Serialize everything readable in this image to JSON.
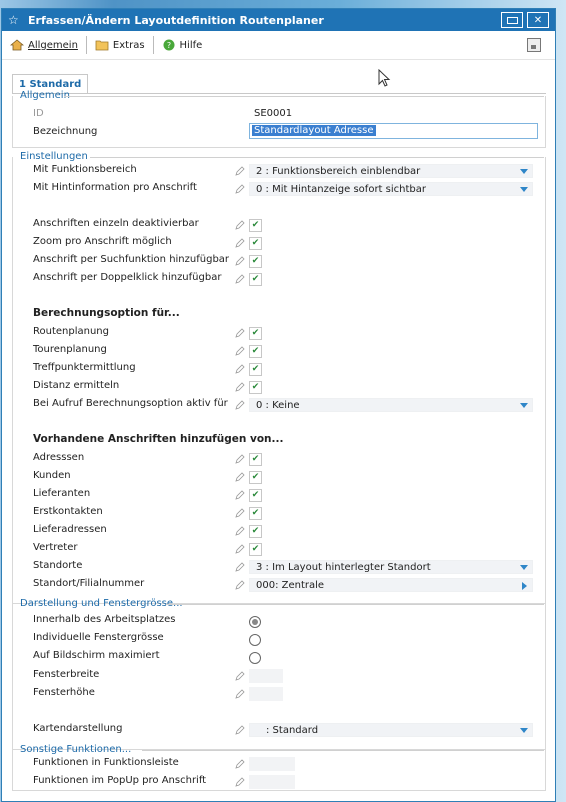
{
  "window": {
    "title": "Erfassen/Ändern Layoutdefinition Routenplaner"
  },
  "toolbar": {
    "allgemein": "Allgemein",
    "extras": "Extras",
    "hilfe": "Hilfe"
  },
  "tab": {
    "label": "1 Standard"
  },
  "sections": {
    "allgemein": "Allgemein",
    "einstellungen": "Einstellungen",
    "darstellung": "Darstellung und Fenstergrösse...",
    "sonstige": "Sonstige Funktionen..."
  },
  "allgemein": {
    "id_label": "ID",
    "id_value": "SE0001",
    "bez_label": "Bezeichnung",
    "bez_value": "Standardlayout Adresse"
  },
  "einstellungen": {
    "funktionsbereich_label": "Mit Funktionsbereich",
    "funktionsbereich_value": "2 : Funktionsbereich einblendbar",
    "hint_label": "Mit Hintinformation pro Anschrift",
    "hint_value": "0 : Mit Hintanzeige sofort sichtbar",
    "c1": "Anschriften einzeln deaktivierbar",
    "c2": "Zoom pro Anschrift möglich",
    "c3": "Anschrift per Suchfunktion hinzufügbar",
    "c4": "Anschrift per Doppelklick hinzufügbar",
    "berechnung_heading": "Berechnungsoption für...",
    "b1": "Routenplanung",
    "b2": "Tourenplanung",
    "b3": "Treffpunktermittlung",
    "b4": "Distanz ermitteln",
    "b5_label": "Bei Aufruf Berechnungsoption aktiv für",
    "b5_value": "0 : Keine",
    "vorhanden_heading": "Vorhandene Anschriften hinzufügen von...",
    "v1": "Adresssen",
    "v2": "Kunden",
    "v3": "Lieferanten",
    "v4": "Erstkontakten",
    "v5": "Lieferadressen",
    "v6": "Vertreter",
    "standorte_label": "Standorte",
    "standorte_value": "3 : Im Layout hinterlegter Standort",
    "filial_label": "Standort/Filialnummer",
    "filial_value": "000: Zentrale"
  },
  "darstellung": {
    "r1": "Innerhalb des Arbeitsplatzes",
    "r2": "Individuelle Fenstergrösse",
    "r3": "Auf Bildschirm maximiert",
    "breite": "Fensterbreite",
    "hoehe": "Fensterhöhe",
    "karte_label": "Kartendarstellung",
    "karte_value": ": Standard"
  },
  "sonstige": {
    "f1": "Funktionen in Funktionsleiste",
    "f2": "Funktionen im PopUp pro Anschrift"
  },
  "colors": {
    "title_bar": "#1f73b5",
    "accent": "#1d6aa8",
    "check": "#2c8a3c"
  }
}
